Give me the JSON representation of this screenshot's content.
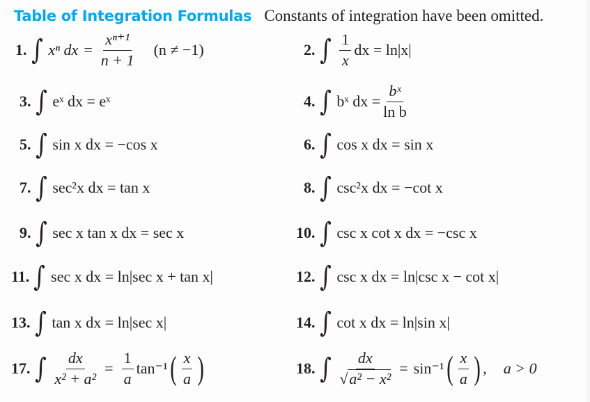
{
  "header": {
    "title": "Table of Integration Formulas",
    "subtitle": "Constants of integration have been omitted.",
    "title_color": "#0aa6e8"
  },
  "formulas": [
    {
      "number": "1.",
      "text": "∫ xⁿ dx = xⁿ⁺¹/(n + 1)   (n ≠ −1)",
      "integrand": "xⁿ dx",
      "num": "xⁿ⁺¹",
      "den": "n + 1",
      "condition": "(n ≠ −1)"
    },
    {
      "number": "2.",
      "text": "∫ (1/x) dx = ln|x|",
      "num": "1",
      "den": "x",
      "rest": "dx = ln|x|"
    },
    {
      "number": "3.",
      "text": "∫ eˣ dx = eˣ",
      "body": "eˣ dx = eˣ"
    },
    {
      "number": "4.",
      "text": "∫ bˣ dx = bˣ / ln b",
      "integrand": "bˣ dx =",
      "num": "bˣ",
      "den": "ln b"
    },
    {
      "number": "5.",
      "text": "∫ sin x dx = −cos x",
      "body": "sin x dx = −cos x"
    },
    {
      "number": "6.",
      "text": "∫ cos x dx = sin x",
      "body": "cos x dx = sin x"
    },
    {
      "number": "7.",
      "text": "∫ sec²x dx = tan x",
      "body": "sec²x dx = tan x"
    },
    {
      "number": "8.",
      "text": "∫ csc²x dx = −cot x",
      "body": "csc²x dx = −cot x"
    },
    {
      "number": "9.",
      "text": "∫ sec x tan x dx = sec x",
      "body": "sec x tan x dx = sec x"
    },
    {
      "number": "10.",
      "text": "∫ csc x cot x dx = −csc x",
      "body": "csc x cot x dx = −csc x"
    },
    {
      "number": "11.",
      "text": "∫ sec x dx = ln|sec x + tan x|",
      "body": "sec x dx = ln|sec x + tan x|"
    },
    {
      "number": "12.",
      "text": "∫ csc x dx = ln|csc x − cot x|",
      "body": "csc x dx = ln|csc x − cot x|"
    },
    {
      "number": "13.",
      "text": "∫ tan x dx = ln|sec x|",
      "body": "tan x dx = ln|sec x|"
    },
    {
      "number": "14.",
      "text": "∫ cot x dx = ln|sin x|",
      "body": "cot x dx = ln|sin x|"
    },
    {
      "number": "17.",
      "text": "∫ dx/(x² + a²) = (1/a) tan⁻¹(x/a)",
      "num": "dx",
      "den": "x² + a²",
      "num2": "1",
      "den2": "a",
      "func": "tan⁻¹",
      "num3": "x",
      "den3": "a"
    },
    {
      "number": "18.",
      "text": "∫ dx/√(a² − x²) = sin⁻¹(x/a),  a > 0",
      "num": "dx",
      "den": "a² − x²",
      "func": "sin⁻¹",
      "num3": "x",
      "den3": "a",
      "condition": "a > 0"
    }
  ]
}
